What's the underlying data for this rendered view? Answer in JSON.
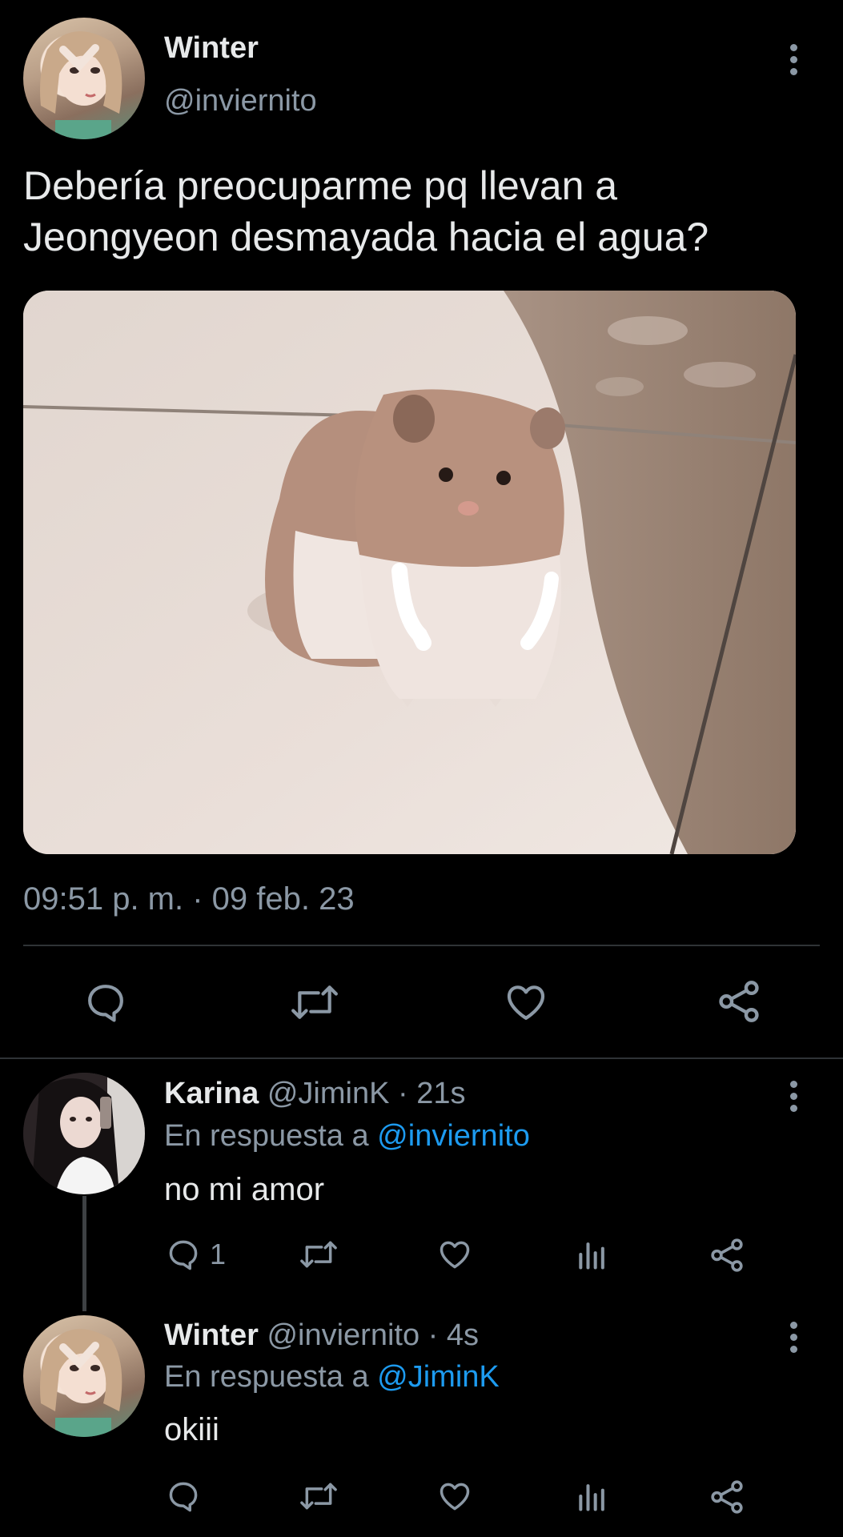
{
  "main_tweet": {
    "author_name": "Winter",
    "author_handle": "@inviernito",
    "text_line1": "Debería preocuparme pq llevan a",
    "text_line2": "Jeongyeon desmayada hacia el agua?",
    "timestamp": "09:51 p. m. · 09 feb. 23",
    "actions": [
      "reply-icon",
      "retweet-icon",
      "like-icon",
      "share-icon"
    ]
  },
  "replies": [
    {
      "author_name": "Karina",
      "author_meta": "@JiminK · 21s",
      "reply_to_prefix": "En respuesta a",
      "reply_to_handle": "@inviernito",
      "text": "no mi amor",
      "reply_count": "1"
    },
    {
      "author_name": "Winter",
      "author_meta": "@inviernito · 4s",
      "reply_to_prefix": "En respuesta a",
      "reply_to_handle": "@JiminK",
      "text": "okiii",
      "reply_count": ""
    }
  ],
  "colors": {
    "background": "#000000",
    "text": "#e7e9ea",
    "muted": "#8b98a5",
    "link": "#1d9bf0",
    "divider": "#2f3336"
  }
}
